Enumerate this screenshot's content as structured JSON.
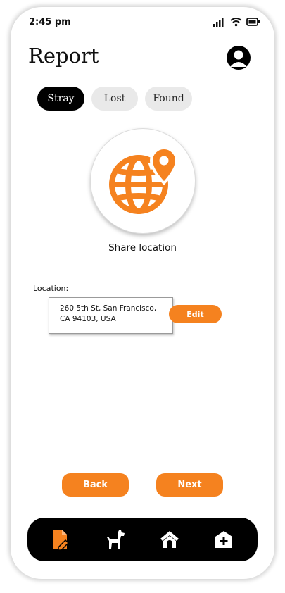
{
  "status_bar": {
    "time": "2:45 pm"
  },
  "header": {
    "title": "Report"
  },
  "tabs": [
    {
      "label": "Stray",
      "active": true
    },
    {
      "label": "Lost",
      "active": false
    },
    {
      "label": "Found",
      "active": false
    }
  ],
  "share": {
    "label": "Share location",
    "icon": "globe-location-pin-icon"
  },
  "location": {
    "label": "Location:",
    "address_line1": "260 5th St, San Francisco,",
    "address_line2": "CA 94103, USA",
    "edit_label": "Edit"
  },
  "actions": {
    "back_label": "Back",
    "next_label": "Next"
  },
  "bottom_nav": [
    {
      "icon": "report-document-icon",
      "active": true
    },
    {
      "icon": "dog-icon",
      "active": false
    },
    {
      "icon": "home-icon",
      "active": false
    },
    {
      "icon": "shelter-add-icon",
      "active": false
    }
  ],
  "colors": {
    "accent": "#f5821f",
    "dark": "#000000",
    "tab_bg": "#e9e9e9"
  }
}
